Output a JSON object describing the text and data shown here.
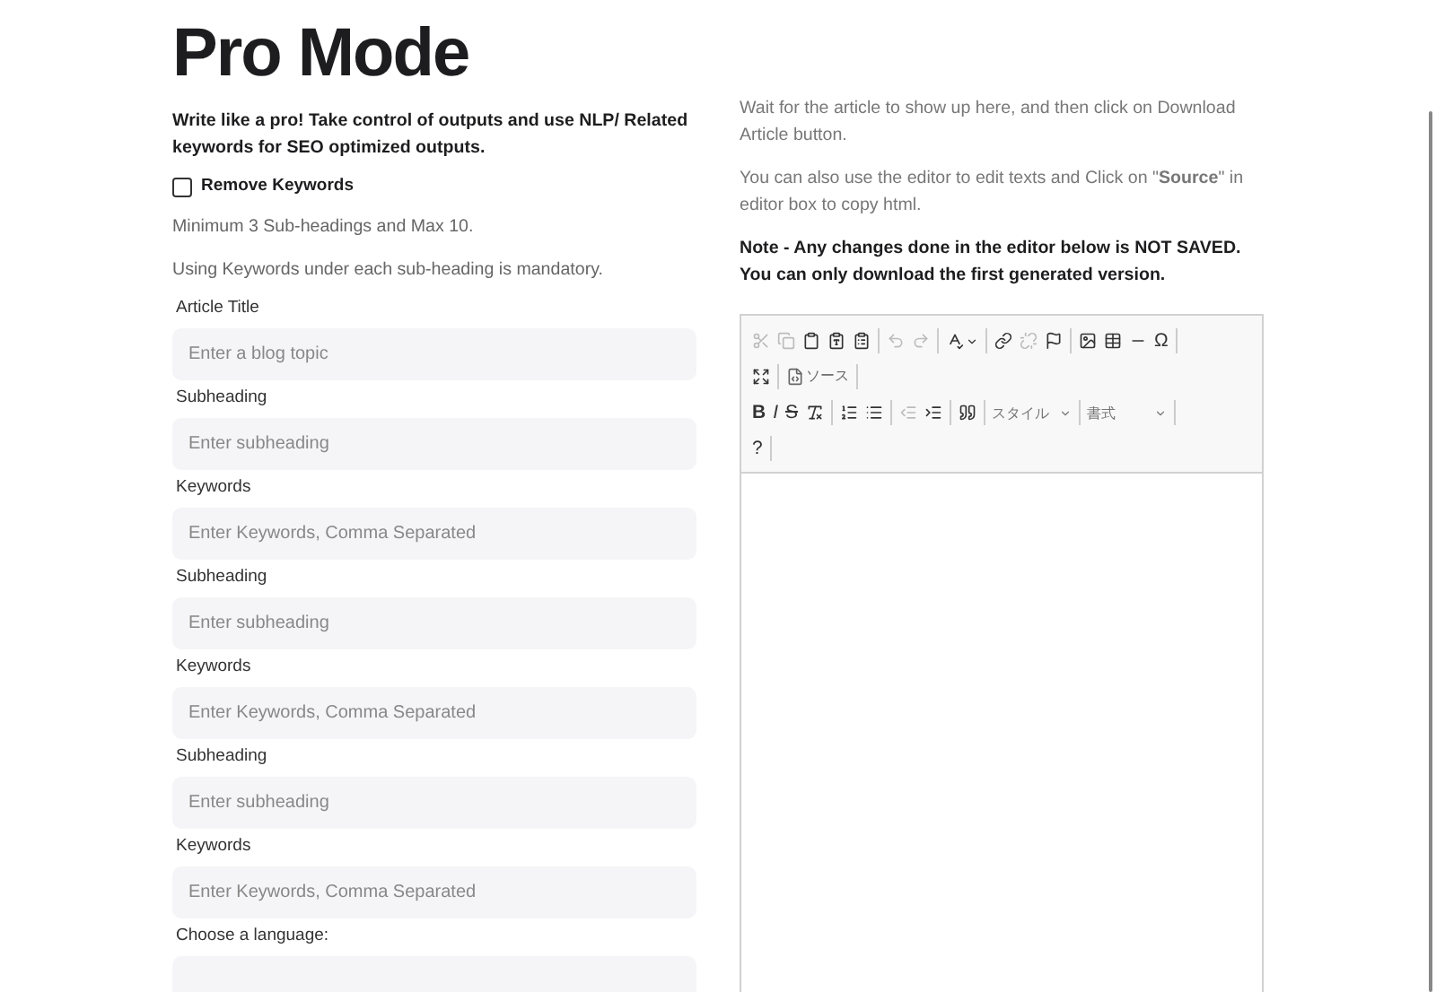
{
  "title": "Pro Mode",
  "intro": "Write like a pro! Take control of outputs and use NLP/ Related keywords for SEO optimized outputs.",
  "remove_keywords": {
    "label": "Remove Keywords",
    "checked": false
  },
  "notes": [
    "Minimum 3 Sub-headings and Max 10.",
    "Using Keywords under each sub-heading is mandatory."
  ],
  "fields": [
    {
      "kind": "input",
      "label": "Article Title",
      "placeholder": "Enter a blog topic"
    },
    {
      "kind": "input",
      "label": "Subheading",
      "placeholder": "Enter subheading"
    },
    {
      "kind": "input",
      "label": "Keywords",
      "placeholder": "Enter Keywords, Comma Separated"
    },
    {
      "kind": "input",
      "label": "Subheading",
      "placeholder": "Enter subheading"
    },
    {
      "kind": "input",
      "label": "Keywords",
      "placeholder": "Enter Keywords, Comma Separated"
    },
    {
      "kind": "input",
      "label": "Subheading",
      "placeholder": "Enter subheading"
    },
    {
      "kind": "input",
      "label": "Keywords",
      "placeholder": "Enter Keywords, Comma Separated"
    },
    {
      "kind": "select",
      "label": "Choose a language:"
    }
  ],
  "instructions": [
    "Wait for the article to show up here, and then click on Download Article button.",
    "You can also use the editor to edit texts and Click on \"**Source**\" in editor box to copy html."
  ],
  "warning": "Note - Any changes done in the editor below is NOT SAVED. You can only download the first generated version.",
  "toolbar": [
    [
      [
        {
          "kind": "icon",
          "disabled": true
        },
        {
          "kind": "icon",
          "disabled": true
        },
        {
          "kind": "icon",
          "disabled": false
        },
        {
          "kind": "icon",
          "disabled": false
        },
        {
          "kind": "icon",
          "disabled": false
        }
      ],
      [
        {
          "kind": "icon",
          "disabled": true
        },
        {
          "kind": "icon",
          "disabled": true
        }
      ],
      [
        {
          "kind": "icon",
          "disabled": false
        }
      ],
      [
        {
          "kind": "icon",
          "disabled": false
        },
        {
          "kind": "icon",
          "disabled": true
        },
        {
          "kind": "icon",
          "disabled": false
        }
      ],
      [
        {
          "kind": "icon",
          "disabled": false
        },
        {
          "kind": "icon",
          "disabled": false
        },
        {
          "kind": "icon",
          "disabled": false
        },
        {
          "kind": "text",
          "label": "Ω",
          "disabled": false
        }
      ]
    ],
    [
      [
        {
          "kind": "icon",
          "disabled": false
        }
      ],
      [
        {
          "kind": "source",
          "label": "ソース",
          "disabled": false
        }
      ]
    ],
    [
      [
        {
          "kind": "text",
          "label": "B",
          "disabled": false
        },
        {
          "kind": "text",
          "label": "I",
          "disabled": false
        },
        {
          "kind": "text",
          "label": "S",
          "disabled": false
        },
        {
          "kind": "icon",
          "disabled": false
        }
      ],
      [
        {
          "kind": "icon",
          "disabled": false
        },
        {
          "kind": "icon",
          "disabled": false
        }
      ],
      [
        {
          "kind": "icon",
          "disabled": true
        },
        {
          "kind": "icon",
          "disabled": false
        }
      ],
      [
        {
          "kind": "icon",
          "disabled": false
        }
      ],
      [
        {
          "kind": "combo",
          "label": "スタイル"
        }
      ],
      [
        {
          "kind": "combo",
          "label": "書式"
        }
      ]
    ],
    [
      [
        {
          "kind": "text",
          "label": "?",
          "disabled": false
        }
      ]
    ]
  ]
}
